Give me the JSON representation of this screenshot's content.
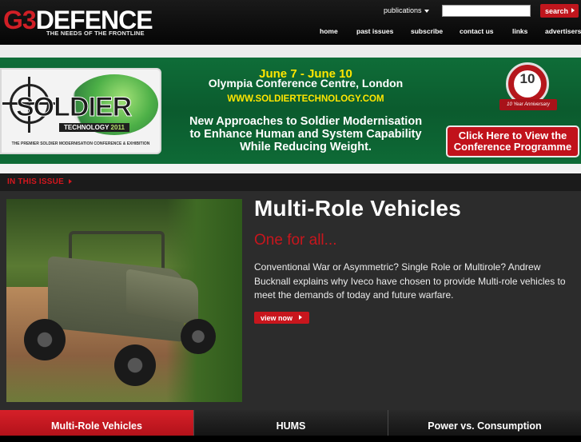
{
  "header": {
    "logo_g3": "G3",
    "logo_defence": "DEFENCE",
    "tagline": "THE NEEDS OF THE FRONTLINE",
    "publications_label": "publications",
    "search_value": "",
    "search_button": "search",
    "nav": [
      {
        "label": "home"
      },
      {
        "label": "past issues"
      },
      {
        "label": "subscribe"
      },
      {
        "label": "contact us"
      },
      {
        "label": "links"
      },
      {
        "label": "advertisers"
      }
    ]
  },
  "banner": {
    "soldier": "SOLDIER",
    "technology": "TECHNOLOGY",
    "year": "2011",
    "card_footer": "THE PREMIER SOLDIER MODERNISATION CONFERENCE & EXHIBITION",
    "dates": "June 7 - June 10",
    "venue": "Olympia Conference Centre, London",
    "url": "WWW.SOLDIERTECHNOLOGY.COM",
    "headline_1": "New Approaches to Soldier Modernisation",
    "headline_2": "to Enhance Human and System Capability",
    "headline_3": "While Reducing Weight.",
    "anniversary_number": "10",
    "anniversary_label": "10 Year Anniversary",
    "cta_1": "Click Here to View the",
    "cta_2": "Conference Programme"
  },
  "issue": {
    "label": "IN THIS ISSUE"
  },
  "feature": {
    "title": "Multi-Role Vehicles",
    "subtitle": "One for all...",
    "description": "Conventional War or Asymmetric? Single Role or Multirole? Andrew Bucknall explains why Iveco have chosen to provide Multi-role vehicles to meet the demands of today and future warfare.",
    "button": "view now"
  },
  "tabs": [
    {
      "label": "Multi-Role Vehicles",
      "active": true
    },
    {
      "label": "HUMS",
      "active": false
    },
    {
      "label": "Power vs. Consumption",
      "active": false
    }
  ],
  "colors": {
    "accent": "#c8161d",
    "banner_green": "#0b5b2e",
    "yellow": "#ffe600"
  }
}
